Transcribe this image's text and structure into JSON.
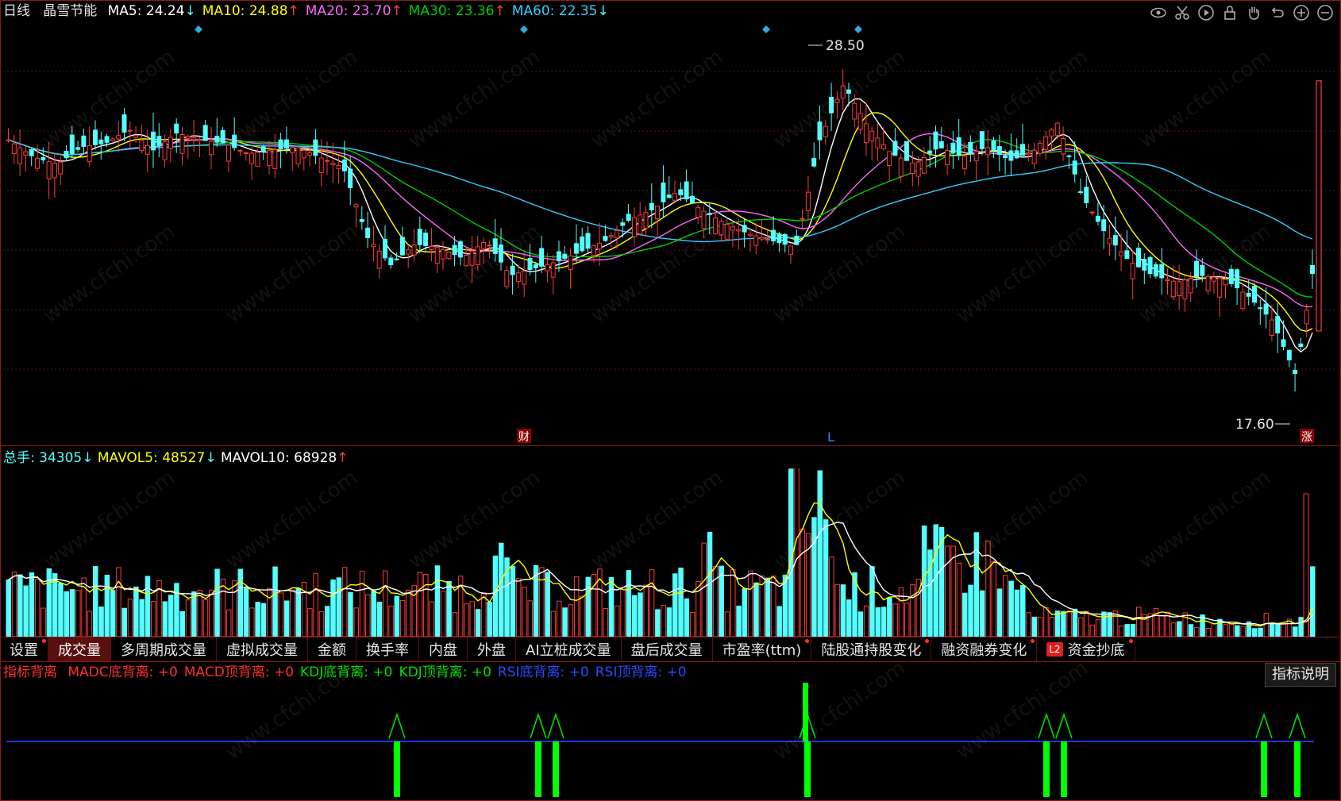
{
  "header": {
    "period": "日线",
    "stock_name": "晶雪节能",
    "ma": [
      {
        "label": "MA5:",
        "value": "24.24",
        "arrow": "↓",
        "color": "#ffffff"
      },
      {
        "label": "MA10:",
        "value": "24.88",
        "arrow": "↑",
        "color": "#ffff00"
      },
      {
        "label": "MA20:",
        "value": "23.70",
        "arrow": "↑",
        "color": "#ff66ff"
      },
      {
        "label": "MA30:",
        "value": "23.36",
        "arrow": "↑",
        "color": "#00d000"
      },
      {
        "label": "MA60:",
        "value": "22.35",
        "arrow": "↓",
        "color": "#33ccff"
      }
    ]
  },
  "price_chart": {
    "high_label": "28.50",
    "low_label": "17.60",
    "markers": {
      "cai": "财",
      "L": "L",
      "zhang": "涨"
    }
  },
  "volume_legend": {
    "total": {
      "label": "总手:",
      "value": "34305",
      "arrow": "↓"
    },
    "mavol5": {
      "label": "MAVOL5:",
      "value": "48527",
      "arrow": "↓"
    },
    "mavol10": {
      "label": "MAVOL10:",
      "value": "68928",
      "arrow": "↑"
    }
  },
  "tabs": [
    {
      "label": "设置",
      "dot": true
    },
    {
      "label": "成交量",
      "dot": false,
      "active": true
    },
    {
      "label": "多周期成交量",
      "dot": false
    },
    {
      "label": "虚拟成交量",
      "dot": false
    },
    {
      "label": "金额",
      "dot": false
    },
    {
      "label": "换手率",
      "dot": false
    },
    {
      "label": "内盘",
      "dot": false
    },
    {
      "label": "外盘",
      "dot": false
    },
    {
      "label": "AI立桩成交量",
      "dot": false
    },
    {
      "label": "盘后成交量",
      "dot": false
    },
    {
      "label": "市盈率(ttm)",
      "dot": true
    },
    {
      "label": "陆股通持股变化",
      "dot": true
    },
    {
      "label": "融资融券变化",
      "dot": true
    },
    {
      "label": "资金抄底",
      "dot": true,
      "badge": "L2"
    }
  ],
  "indicator": {
    "title": "指标背离",
    "items": [
      {
        "label": "MADC底背离:",
        "value": "+0",
        "color": "#ff3030"
      },
      {
        "label": "MACD顶背离:",
        "value": "+0",
        "color": "#ff3030"
      },
      {
        "label": "KDJ底背离:",
        "value": "+0",
        "color": "#00e000"
      },
      {
        "label": "KDJ顶背离:",
        "value": "+0",
        "color": "#00e000"
      },
      {
        "label": "RSI底背离:",
        "value": "+0",
        "color": "#2a4cff"
      },
      {
        "label": "RSI顶背离:",
        "value": "+0",
        "color": "#2a4cff"
      }
    ],
    "explain_button": "指标说明"
  },
  "icons": [
    "eye-icon",
    "scissors-icon",
    "play-icon",
    "lock-icon",
    "hand-icon",
    "undo-icon",
    "zoom-in-icon",
    "zoom-out-icon"
  ],
  "watermark": "www.cfchi.com",
  "colors": {
    "up": "#ff3b3b",
    "down": "#54ffff",
    "frame": "#8b1a1a"
  }
}
